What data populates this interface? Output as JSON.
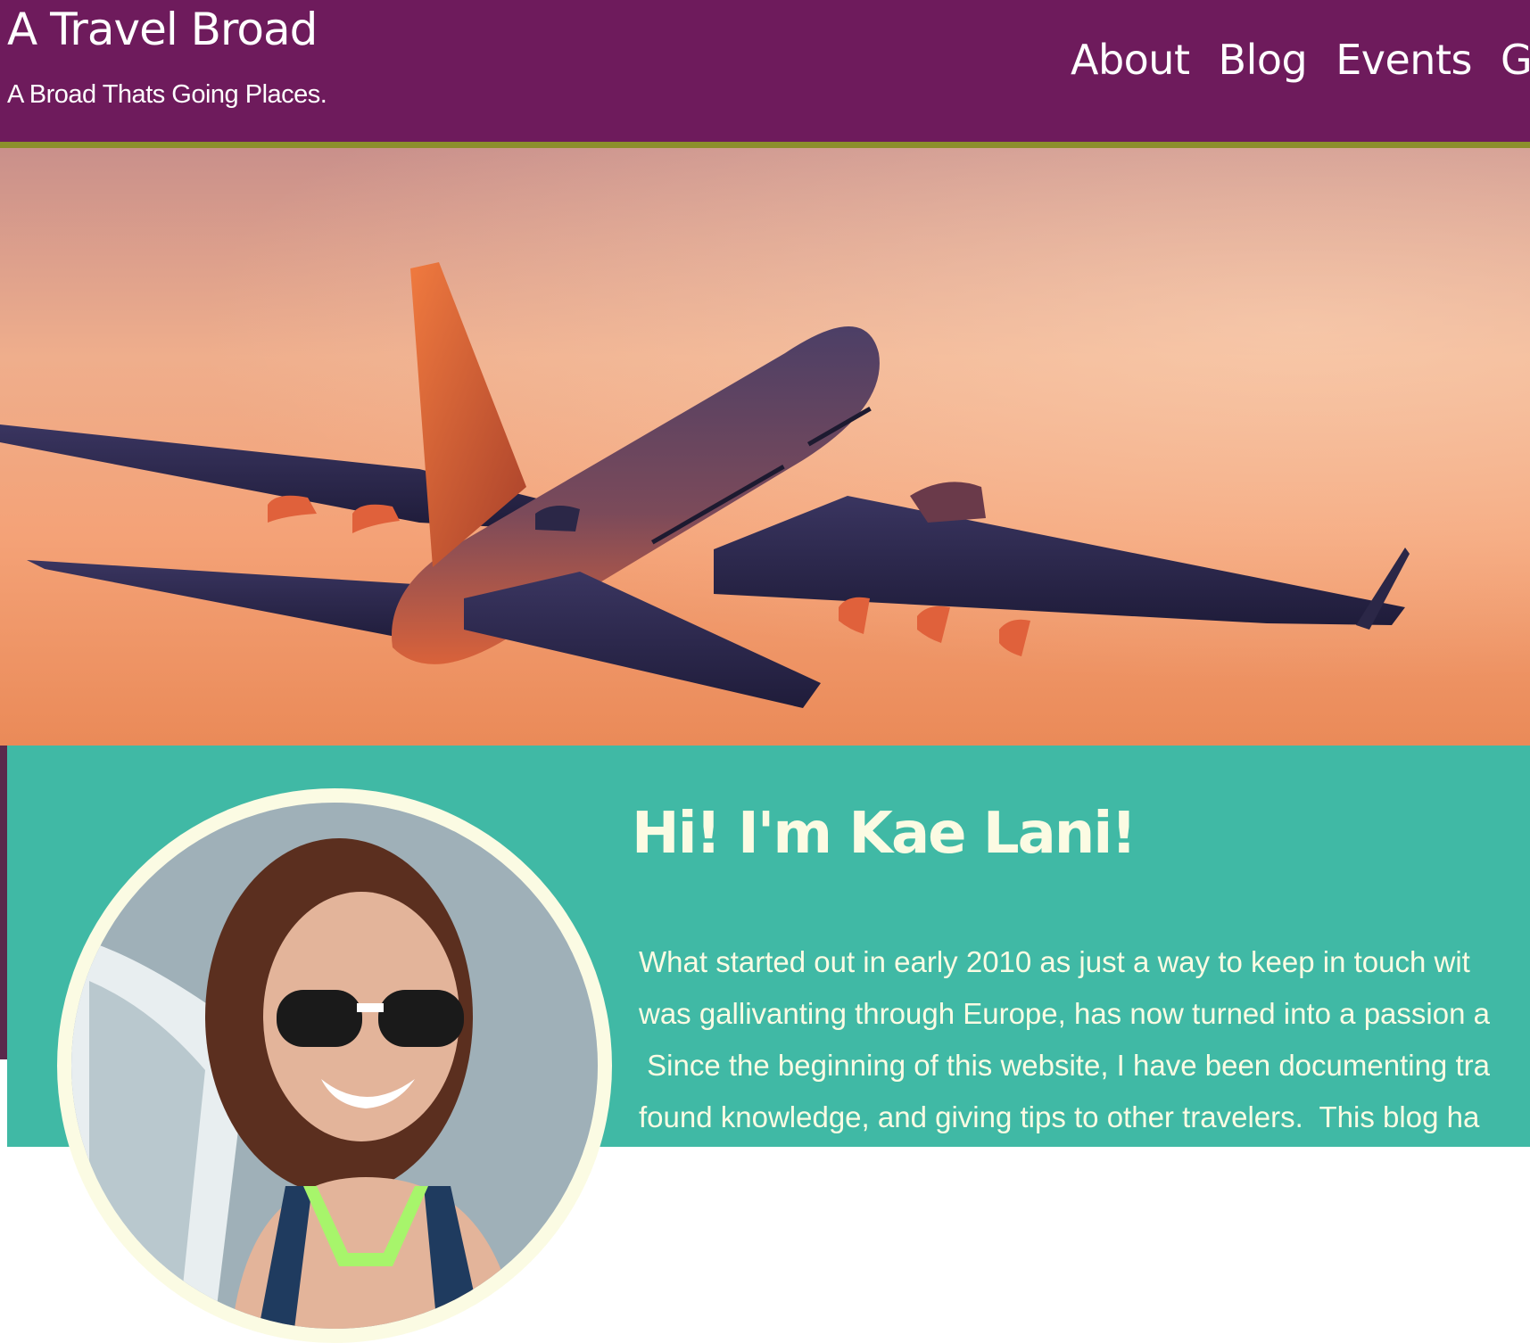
{
  "header": {
    "site_title": "A Travel Broad",
    "tagline": "A Broad Thats Going Places.",
    "background_color": "#6e1b5c",
    "border_color": "#8c8f2c"
  },
  "nav": {
    "items": [
      {
        "label": "About"
      },
      {
        "label": "Blog"
      },
      {
        "label": "Events"
      },
      {
        "label": "Ga"
      }
    ]
  },
  "hero": {
    "image": "airplane-at-sunset"
  },
  "about": {
    "background_color": "#40b9a5",
    "text_color": "#fbfbe3",
    "heading": "Hi! I'm Kae Lani!",
    "paragraph_lines": [
      "What started out in early 2010 as just a way to keep in touch wit",
      "was gallivanting through Europe, has now turned into a passion a",
      " Since the beginning of this website, I have been documenting tra",
      "found knowledge, and giving tips to other travelers.  This blog ha"
    ],
    "profile_photo": "profile-photo"
  }
}
